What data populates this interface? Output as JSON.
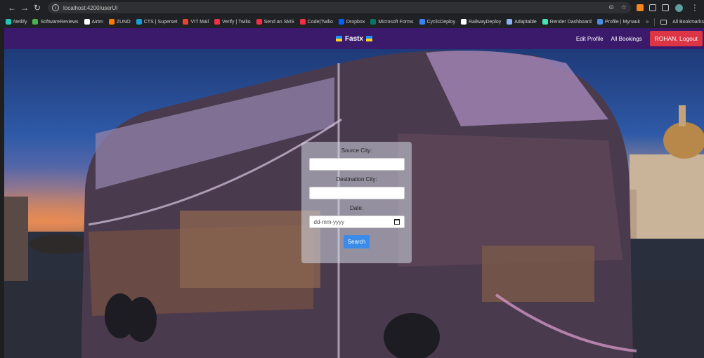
{
  "browser": {
    "url": "localhost:4200/userUI",
    "bookmarks": [
      {
        "label": "Netlify",
        "color": "#20c6b7"
      },
      {
        "label": "SoftwareReviews",
        "color": "#4caf50"
      },
      {
        "label": "Airtm",
        "color": "#ffffff"
      },
      {
        "label": "ZUNO",
        "color": "#ff7a00"
      },
      {
        "label": "CTS | Superset",
        "color": "#1a9ad6"
      },
      {
        "label": "VIT Mail",
        "color": "#ea4335"
      },
      {
        "label": "Verify | Twilio",
        "color": "#f22f46"
      },
      {
        "label": "Send an SMS",
        "color": "#f22f46"
      },
      {
        "label": "Code|Twilio",
        "color": "#f22f46"
      },
      {
        "label": "Dropbox",
        "color": "#0061ff"
      },
      {
        "label": "Microsoft Forms",
        "color": "#077568"
      },
      {
        "label": "CyclicDeploy",
        "color": "#3b82f6"
      },
      {
        "label": "RailwayDeploy",
        "color": "#ffffff"
      },
      {
        "label": "Adaptable",
        "color": "#8ab4f8"
      },
      {
        "label": "Render Dashboard",
        "color": "#46e3b7"
      },
      {
        "label": "Profile | Mynaukri",
        "color": "#4a90e2"
      }
    ],
    "more_label": "»",
    "all_bookmarks": "All Bookmarks"
  },
  "navbar": {
    "brand": "Fastx",
    "links": [
      "Edit Profile",
      "All Bookings"
    ],
    "logout": "ROHAN, Logout"
  },
  "form": {
    "source_label": "Source City:",
    "source_value": "",
    "destination_label": "Destination City:",
    "destination_value": "",
    "date_label": "Date:",
    "date_placeholder": "dd-mm-yyyy",
    "search_label": "Search"
  },
  "colors": {
    "navbar": "#3b1a6b",
    "logout": "#dc3545",
    "search": "#3b8be8"
  }
}
